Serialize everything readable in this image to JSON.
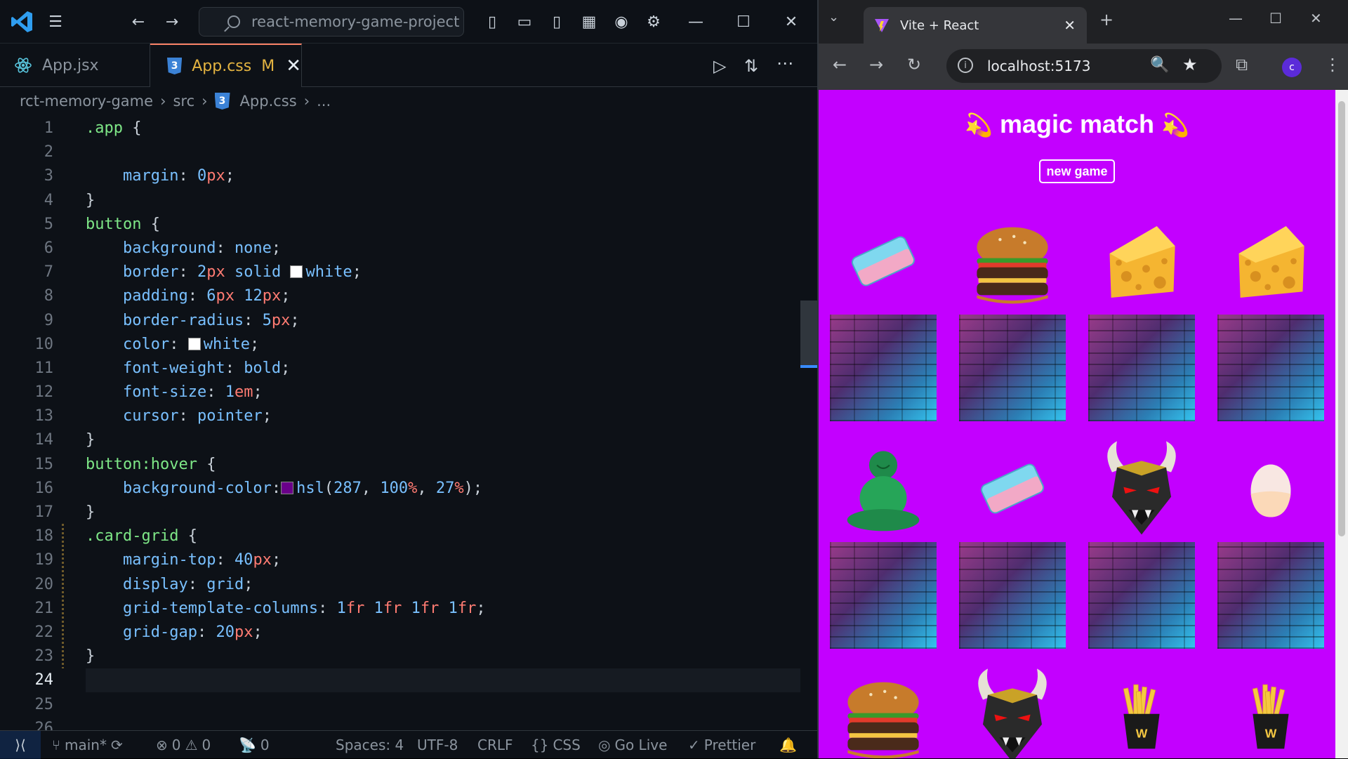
{
  "vscode": {
    "search": "react-memory-game-project",
    "tabs": [
      {
        "label": "App.jsx"
      },
      {
        "label": "App.css",
        "modified": "M"
      }
    ],
    "breadcrumb": [
      "rct-memory-game",
      "src",
      "App.css",
      "..."
    ],
    "lines": [
      [
        [
          "cl",
          ".app"
        ],
        [
          "pu",
          " {"
        ]
      ],
      [],
      [
        [
          "pu",
          "    "
        ],
        [
          "pr",
          "margin"
        ],
        [
          "pu",
          ": "
        ],
        [
          "nu",
          "0"
        ],
        [
          "un",
          "px"
        ],
        [
          "pu",
          ";"
        ]
      ],
      [
        [
          "pu",
          "}"
        ]
      ],
      [
        [
          "cl",
          "button"
        ],
        [
          "pu",
          " {"
        ]
      ],
      [
        [
          "pu",
          "    "
        ],
        [
          "pr",
          "background"
        ],
        [
          "pu",
          ": "
        ],
        [
          "pr",
          "none"
        ],
        [
          "pu",
          ";"
        ]
      ],
      [
        [
          "pu",
          "    "
        ],
        [
          "pr",
          "border"
        ],
        [
          "pu",
          ": "
        ],
        [
          "nu",
          "2"
        ],
        [
          "un",
          "px"
        ],
        [
          "pu",
          " "
        ],
        [
          "pr",
          "solid"
        ],
        [
          "pu",
          " "
        ],
        [
          "sw",
          "#ffffff"
        ],
        [
          "pr",
          "white"
        ],
        [
          "pu",
          ";"
        ]
      ],
      [
        [
          "pu",
          "    "
        ],
        [
          "pr",
          "padding"
        ],
        [
          "pu",
          ": "
        ],
        [
          "nu",
          "6"
        ],
        [
          "un",
          "px"
        ],
        [
          "pu",
          " "
        ],
        [
          "nu",
          "12"
        ],
        [
          "un",
          "px"
        ],
        [
          "pu",
          ";"
        ]
      ],
      [
        [
          "pu",
          "    "
        ],
        [
          "pr",
          "border-radius"
        ],
        [
          "pu",
          ": "
        ],
        [
          "nu",
          "5"
        ],
        [
          "un",
          "px"
        ],
        [
          "pu",
          ";"
        ]
      ],
      [
        [
          "pu",
          "    "
        ],
        [
          "pr",
          "color"
        ],
        [
          "pu",
          ": "
        ],
        [
          "sw",
          "#ffffff"
        ],
        [
          "pr",
          "white"
        ],
        [
          "pu",
          ";"
        ]
      ],
      [
        [
          "pu",
          "    "
        ],
        [
          "pr",
          "font-weight"
        ],
        [
          "pu",
          ": "
        ],
        [
          "pr",
          "bold"
        ],
        [
          "pu",
          ";"
        ]
      ],
      [
        [
          "pu",
          "    "
        ],
        [
          "pr",
          "font-size"
        ],
        [
          "pu",
          ": "
        ],
        [
          "nu",
          "1"
        ],
        [
          "un",
          "em"
        ],
        [
          "pu",
          ";"
        ]
      ],
      [
        [
          "pu",
          "    "
        ],
        [
          "pr",
          "cursor"
        ],
        [
          "pu",
          ": "
        ],
        [
          "pr",
          "pointer"
        ],
        [
          "pu",
          ";"
        ]
      ],
      [
        [
          "pu",
          "}"
        ]
      ],
      [
        [
          "cl",
          "button:hover"
        ],
        [
          "pu",
          " {"
        ]
      ],
      [
        [
          "pu",
          "    "
        ],
        [
          "pr",
          "background-color"
        ],
        [
          "pu",
          ":"
        ],
        [
          "sw",
          "#6a008a"
        ],
        [
          "pr",
          "hsl"
        ],
        [
          "pu",
          "("
        ],
        [
          "nu",
          "287"
        ],
        [
          "pu",
          ", "
        ],
        [
          "nu",
          "100"
        ],
        [
          "un",
          "%"
        ],
        [
          "pu",
          ", "
        ],
        [
          "nu",
          "27"
        ],
        [
          "un",
          "%"
        ],
        [
          "pu",
          ");"
        ]
      ],
      [
        [
          "pu",
          "}"
        ]
      ],
      [
        [
          "cl",
          ".card-grid"
        ],
        [
          "pu",
          " {"
        ]
      ],
      [
        [
          "pu",
          "    "
        ],
        [
          "pr",
          "margin-top"
        ],
        [
          "pu",
          ": "
        ],
        [
          "nu",
          "40"
        ],
        [
          "un",
          "px"
        ],
        [
          "pu",
          ";"
        ]
      ],
      [
        [
          "pu",
          "    "
        ],
        [
          "pr",
          "display"
        ],
        [
          "pu",
          ": "
        ],
        [
          "pr",
          "grid"
        ],
        [
          "pu",
          ";"
        ]
      ],
      [
        [
          "pu",
          "    "
        ],
        [
          "pr",
          "grid-template-columns"
        ],
        [
          "pu",
          ": "
        ],
        [
          "nu",
          "1"
        ],
        [
          "un",
          "fr"
        ],
        [
          "pu",
          " "
        ],
        [
          "nu",
          "1"
        ],
        [
          "un",
          "fr"
        ],
        [
          "pu",
          " "
        ],
        [
          "nu",
          "1"
        ],
        [
          "un",
          "fr"
        ],
        [
          "pu",
          " "
        ],
        [
          "nu",
          "1"
        ],
        [
          "un",
          "fr"
        ],
        [
          "pu",
          ";"
        ]
      ],
      [
        [
          "pu",
          "    "
        ],
        [
          "pr",
          "grid-gap"
        ],
        [
          "pu",
          ": "
        ],
        [
          "nu",
          "20"
        ],
        [
          "un",
          "px"
        ],
        [
          "pu",
          ";"
        ]
      ],
      [
        [
          "pu",
          "}"
        ]
      ],
      [],
      [],
      []
    ],
    "current_line": 24,
    "status": {
      "branch": "main*",
      "errors": "0",
      "warnings": "0",
      "ports": "0",
      "spaces": "Spaces: 4",
      "encoding": "UTF-8",
      "eol": "CRLF",
      "language": "CSS",
      "golive": "Go Live",
      "prettier": "Prettier"
    }
  },
  "chrome": {
    "tab_title": "Vite + React",
    "url": "localhost:5173",
    "avatar": "c",
    "page": {
      "title": "magic match",
      "button": "new game",
      "bg": "#c300ff",
      "cards": [
        "eraser",
        "burger",
        "cheese",
        "cheese",
        "buddha",
        "eraser",
        "demon-mask",
        "egg",
        "burger",
        "demon-mask",
        "fries",
        "fries"
      ]
    }
  }
}
